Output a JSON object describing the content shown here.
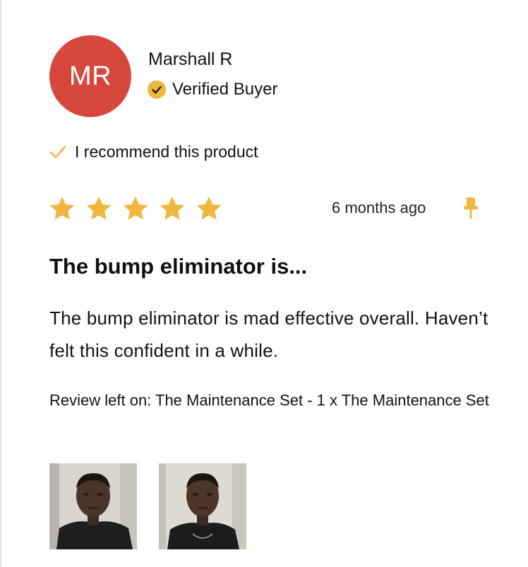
{
  "review": {
    "author": {
      "initials": "MR",
      "name": "Marshall R",
      "avatar_color": "#d6483d",
      "verified_label": "Verified Buyer"
    },
    "recommend_text": "I recommend this product",
    "rating": 5,
    "rating_max": 5,
    "date": "6 months ago",
    "title": "The bump eliminator is...",
    "body": "The bump eliminator is mad effective overall. Haven’t felt this confident in a while.",
    "product_line": "Review left on: The Maintenance Set - 1 x The Maintenance Set",
    "photos": [
      {
        "icon": "review-photo-thumbnail"
      },
      {
        "icon": "review-photo-thumbnail"
      }
    ]
  },
  "colors": {
    "accent": "#f0b73f",
    "avatar": "#d6483d",
    "text": "#111111"
  },
  "icons": {
    "verified": "verified-check-icon",
    "recommend": "checkmark-icon",
    "star": "star-icon",
    "pin": "pin-icon"
  }
}
